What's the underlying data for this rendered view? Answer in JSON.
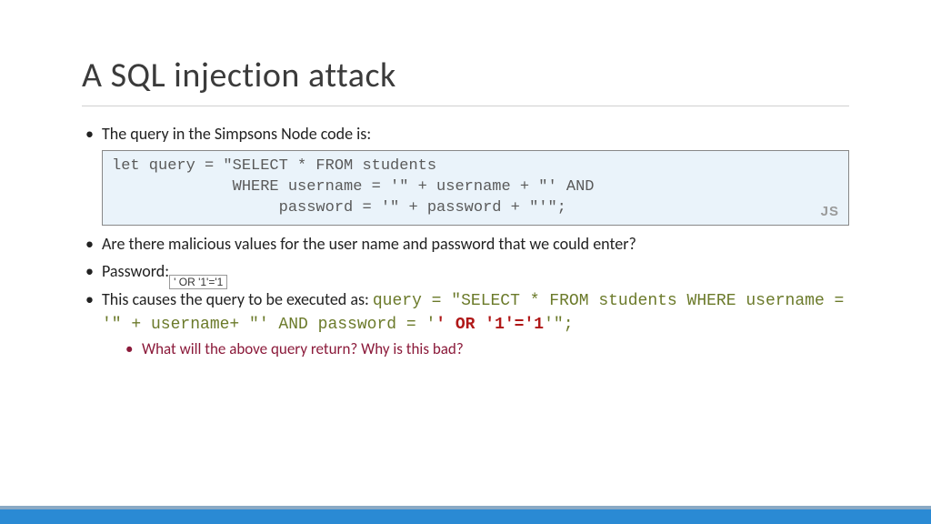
{
  "title": "A SQL injection attack",
  "bullets": {
    "b1": "The query in the Simpsons Node code is:",
    "codeblock": "let query = \"SELECT * FROM students\n             WHERE username = '\" + username + \"' AND\n                  password = '\" + password + \"'\";",
    "lang": "JS",
    "b2": "Are there malicious values for the user name and password that we could enter?",
    "b3_label": "Password:",
    "b3_input": "' OR '1'='1",
    "b4_lead": "This causes the query to be executed as:  ",
    "b4_code_part1": "query = \"SELECT * FROM students WHERE username = '\" + username+ \"' AND password = '",
    "b4_code_injected": "' OR '1'='1",
    "b4_code_part2": "'\";",
    "sub1": "What will the above query return? Why is this bad?"
  }
}
